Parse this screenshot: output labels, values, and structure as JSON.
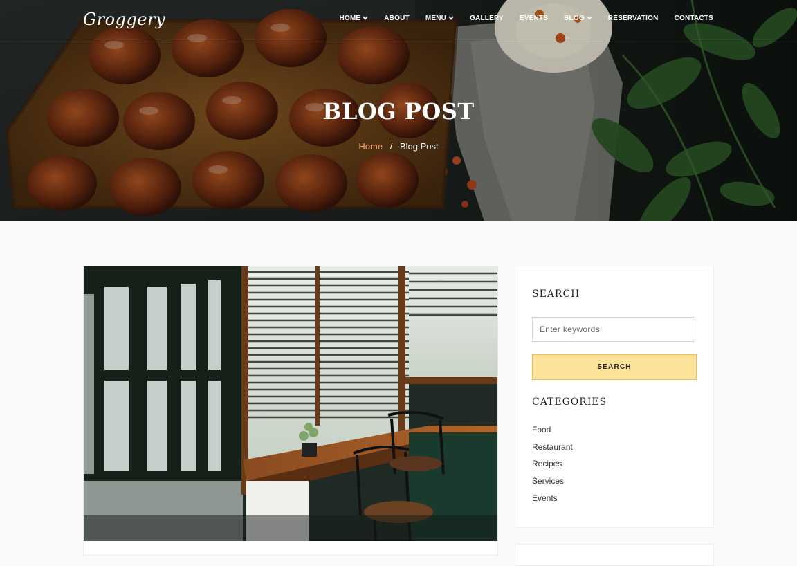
{
  "brand": {
    "logo_text": "Groggery"
  },
  "nav": {
    "items": [
      {
        "label": "HOME",
        "has_dropdown": true
      },
      {
        "label": "ABOUT",
        "has_dropdown": false
      },
      {
        "label": "MENU",
        "has_dropdown": true
      },
      {
        "label": "GALLERY",
        "has_dropdown": false
      },
      {
        "label": "EVENTS",
        "has_dropdown": false
      },
      {
        "label": "BLOG",
        "has_dropdown": true
      },
      {
        "label": "RESERVATION",
        "has_dropdown": false
      },
      {
        "label": "CONTACTS",
        "has_dropdown": false
      }
    ],
    "dropdown_icon": "chevron-down-icon"
  },
  "hero": {
    "title": "BLOG POST",
    "breadcrumb": {
      "home": "Home",
      "separator": "/",
      "current": "Blog Post"
    }
  },
  "sidebar": {
    "search": {
      "title": "SEARCH",
      "placeholder": "Enter keywords",
      "button_label": "SEARCH"
    },
    "categories": {
      "title": "CATEGORIES",
      "items": [
        "Food",
        "Restaurant",
        "Recipes",
        "Services",
        "Events"
      ]
    }
  },
  "colors": {
    "accent_link": "#f2a46f",
    "search_button": "#fde29a",
    "search_button_border": "#f2c14f"
  }
}
